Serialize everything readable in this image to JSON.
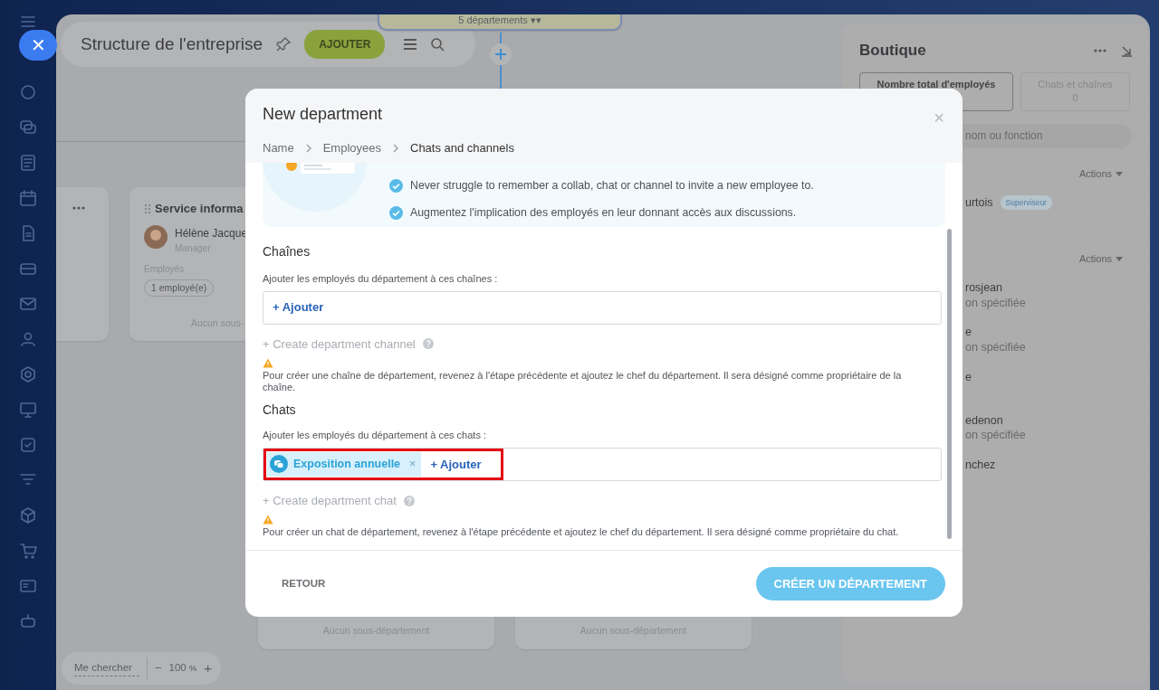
{
  "sidebar": {
    "close": "✕"
  },
  "header": {
    "title": "Structure de l'entreprise",
    "add_button": "AJOUTER"
  },
  "chart": {
    "top_node": "5 départements ▾▾",
    "cards": [
      {
        "title": "Service informa",
        "person": "Hélène Jacque",
        "role": "Manager",
        "employees_label": "Employés",
        "employees": "1 employé(e)",
        "footer": "Aucun sous-"
      }
    ],
    "bottom_cards": [
      "Aucun sous-département",
      "Aucun sous-département"
    ]
  },
  "side_panel": {
    "title": "Boutique",
    "tabs": [
      {
        "label": "Nombre total d'employés",
        "selected": true
      },
      {
        "label": "Chats et chaînes",
        "value": "0",
        "selected": false
      }
    ],
    "search_placeholder": "nom ou fonction",
    "groups": [
      {
        "actions": "Actions",
        "people": [
          {
            "name": "urtois",
            "badge": "Superviseur"
          }
        ]
      },
      {
        "actions": "Actions",
        "people": [
          {
            "name": "rosjean",
            "role": "on spécifiée"
          },
          {
            "name": "e",
            "role": "on spécifiée"
          },
          {
            "name": "e"
          },
          {
            "name": "edenon",
            "role": "on spécifiée"
          },
          {
            "name": "nchez"
          }
        ]
      }
    ]
  },
  "zoom_bar": {
    "find_me": "Me chercher",
    "minus": "−",
    "zoom": "100",
    "unit": "%",
    "plus": "+"
  },
  "modal": {
    "title": "New department",
    "close": "×",
    "breadcrumb": [
      {
        "label": "Name",
        "selected": false
      },
      {
        "label": "Employees",
        "selected": false
      },
      {
        "label": "Chats and channels",
        "selected": true
      }
    ],
    "benefits": [
      {
        "text": "Never struggle to remember a collab, chat or channel to invite a new employee to.",
        "checked": true
      },
      {
        "text": "Augmentez l'implication des employés en leur donnant accès aux discussions.",
        "checked": true
      }
    ],
    "sections": [
      {
        "heading": "Chaînes",
        "label": "Ajouter les employés du département à ces chaînes :",
        "add": "+ Ajouter",
        "highlighted": false,
        "create": "+ Create department channel",
        "create_disabled": true,
        "warning": "Pour créer une chaîne de département, revenez à l'étape précédente et ajoutez le chef du département. Il sera désigné comme propriétaire de la chaîne."
      },
      {
        "heading": "Chats",
        "label": "Ajouter les employés du département à ces chats :",
        "tags": [
          {
            "label": "Exposition annuelle",
            "remove": "×"
          }
        ],
        "add": "+ Ajouter",
        "highlighted": true,
        "create": "+ Create department chat",
        "create_disabled": true,
        "warning": "Pour créer un chat de département, revenez à l'étape précédente et ajoutez le chef du département. Il sera désigné comme propriétaire du chat."
      }
    ],
    "back_button": "RETOUR",
    "create_button": "CRÉER UN DÉPARTEMENT"
  }
}
